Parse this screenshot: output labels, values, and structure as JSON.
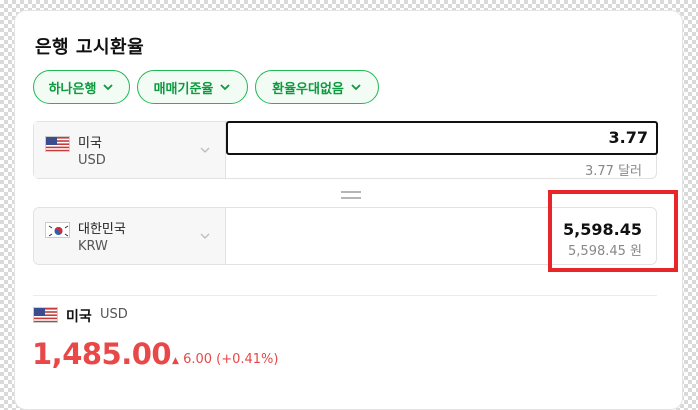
{
  "title": "은행 고시환율",
  "filters": [
    {
      "label": "하나은행"
    },
    {
      "label": "매매기준율"
    },
    {
      "label": "환율우대없음"
    }
  ],
  "from": {
    "country": "미국",
    "code": "USD",
    "amount": "3.77",
    "amount_text": "3.77 달러",
    "flag": "us-flag-icon"
  },
  "to": {
    "country": "대한민국",
    "code": "KRW",
    "amount": "5,598.45",
    "amount_text": "5,598.45 원",
    "flag": "kr-flag-icon"
  },
  "rate_info": {
    "country": "미국",
    "code": "USD",
    "rate": "1,485.00",
    "change": "6.00 (+0.41%)",
    "direction": "up"
  },
  "colors": {
    "accent_green": "#1fb955",
    "up_red": "#e84848",
    "highlight_red": "#e8262a"
  }
}
